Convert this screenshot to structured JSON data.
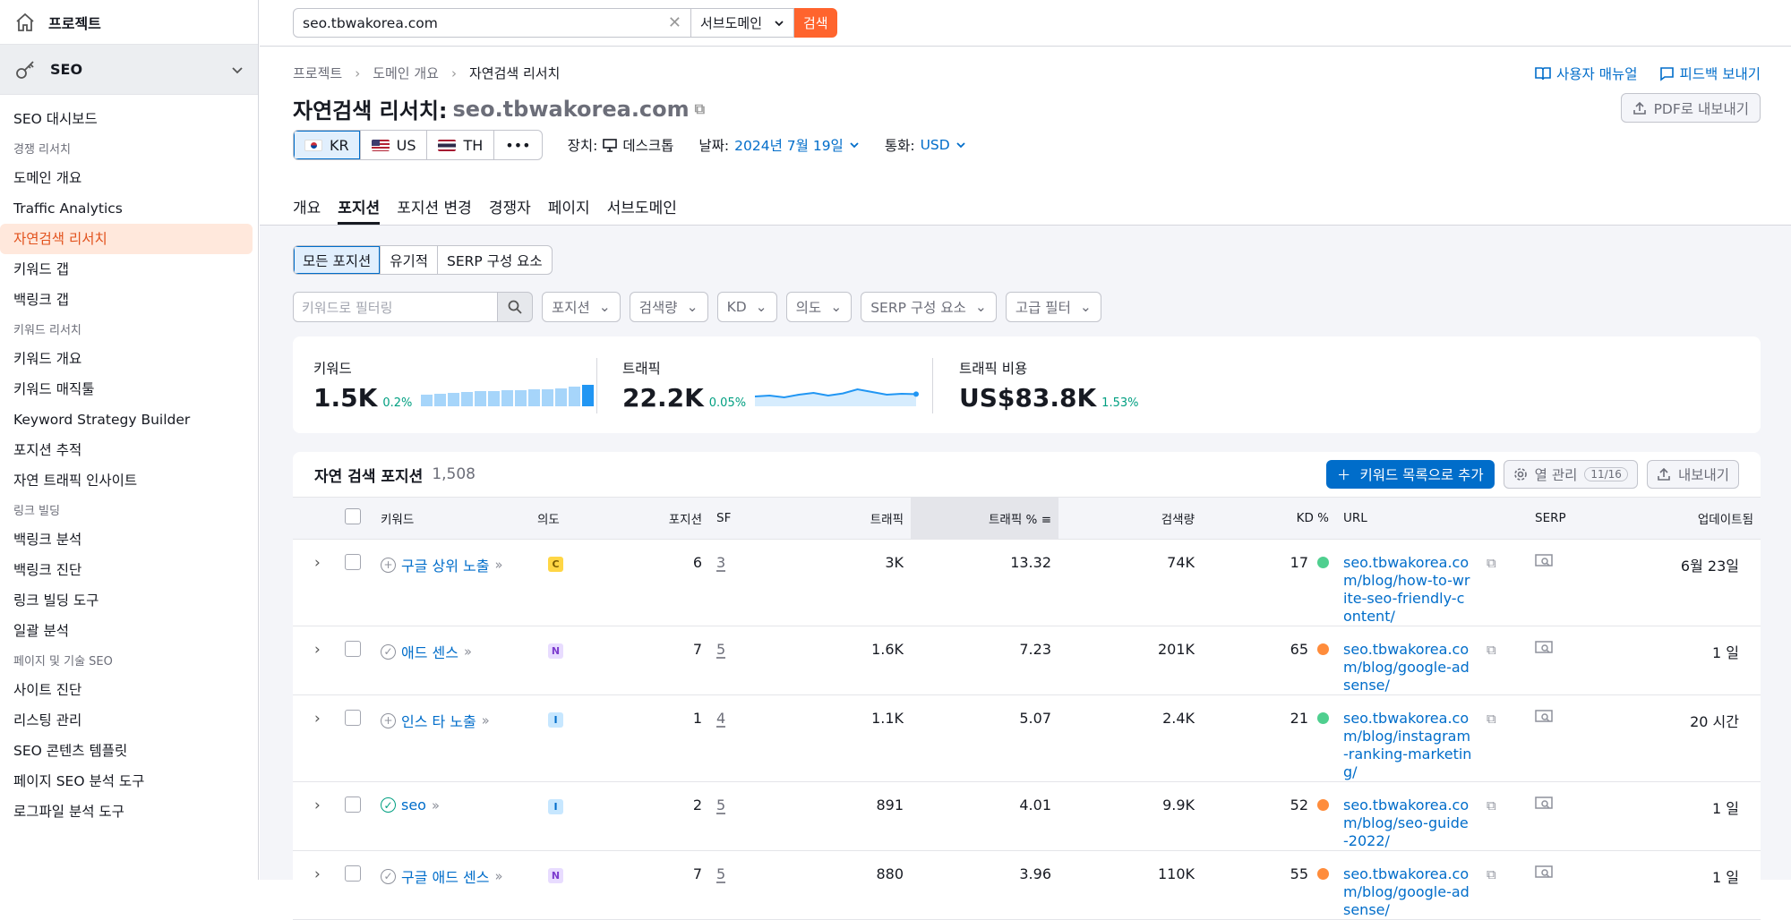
{
  "sidebar": {
    "projects": "프로젝트",
    "seo": "SEO",
    "items": [
      {
        "type": "item",
        "label": "SEO 대시보드"
      },
      {
        "type": "head",
        "label": "경쟁 리서치"
      },
      {
        "type": "item",
        "label": "도메인 개요"
      },
      {
        "type": "item",
        "label": "Traffic Analytics"
      },
      {
        "type": "item",
        "label": "자연검색 리서치",
        "active": true
      },
      {
        "type": "item",
        "label": "키워드 갭"
      },
      {
        "type": "item",
        "label": "백링크 갭"
      },
      {
        "type": "head",
        "label": "키워드 리서치"
      },
      {
        "type": "item",
        "label": "키워드 개요"
      },
      {
        "type": "item",
        "label": "키워드 매직툴"
      },
      {
        "type": "item",
        "label": "Keyword Strategy Builder"
      },
      {
        "type": "item",
        "label": "포지션 추적"
      },
      {
        "type": "item",
        "label": "자연 트래픽 인사이트"
      },
      {
        "type": "head",
        "label": "링크 빌딩"
      },
      {
        "type": "item",
        "label": "백링크 분석"
      },
      {
        "type": "item",
        "label": "백링크 진단"
      },
      {
        "type": "item",
        "label": "링크 빌딩 도구"
      },
      {
        "type": "item",
        "label": "일괄 분석"
      },
      {
        "type": "head",
        "label": "페이지 및 기술 SEO"
      },
      {
        "type": "item",
        "label": "사이트 진단"
      },
      {
        "type": "item",
        "label": "리스팅 관리"
      },
      {
        "type": "item",
        "label": "SEO 콘텐츠 템플릿"
      },
      {
        "type": "item",
        "label": "페이지 SEO 분석 도구"
      },
      {
        "type": "item",
        "label": "로그파일 분석 도구"
      }
    ]
  },
  "search": {
    "domain": "seo.tbwakorea.com",
    "scope": "서브도메인",
    "button": "검색"
  },
  "breadcrumb": {
    "a": "프로젝트",
    "b": "도메인 개요",
    "c": "자연검색 리서치"
  },
  "links": {
    "manual": "사용자 매뉴얼",
    "feedback": "피드백 보내기",
    "pdf": "PDF로 내보내기"
  },
  "title": {
    "label": "자연검색 리서치:",
    "domain": "seo.tbwakorea.com"
  },
  "db": {
    "kr": "KR",
    "us": "US",
    "th": "TH",
    "more": "•••"
  },
  "meta": {
    "device_label": "장치:",
    "device": "데스크톱",
    "date_label": "날짜:",
    "date": "2024년 7월 19일",
    "cur_label": "통화:",
    "currency": "USD"
  },
  "tabs": [
    "개요",
    "포지션",
    "포지션 변경",
    "경쟁자",
    "페이지",
    "서브도메인"
  ],
  "segments": [
    "모든 포지션",
    "유기적",
    "SERP 구성 요소"
  ],
  "filters": {
    "placeholder": "키워드로 필터링",
    "dd": [
      "포지션",
      "검색량",
      "KD",
      "의도",
      "SERP 구성 요소",
      "고급 필터"
    ]
  },
  "kpis": {
    "kw_label": "키워드",
    "kw_value": "1.5K",
    "kw_change": "0.2%",
    "tr_label": "트래픽",
    "tr_value": "22.2K",
    "tr_change": "0.05%",
    "cost_label": "트래픽 비용",
    "cost_value": "US$83.8K",
    "cost_change": "1.53%",
    "kw_bars": [
      0.55,
      0.6,
      0.62,
      0.68,
      0.72,
      0.7,
      0.74,
      0.76,
      0.78,
      0.8,
      0.82,
      0.92,
      1.0
    ],
    "tr_line": [
      0.45,
      0.5,
      0.4,
      0.55,
      0.65,
      0.5,
      0.62,
      0.85,
      0.7,
      0.55,
      0.6,
      0.58
    ]
  },
  "table": {
    "title": "자연 검색 포지션",
    "count": "1,508",
    "add": "키워드 목록으로 추가",
    "cols_label": "열 관리",
    "cols_count": "11/16",
    "export": "내보내기",
    "headers": {
      "kw": "키워드",
      "intent": "의도",
      "pos": "포지션",
      "sf": "SF",
      "traffic": "트래픽",
      "tpct": "트래픽 %",
      "vol": "검색량",
      "kd": "KD %",
      "url": "URL",
      "serp": "SERP",
      "upd": "업데이트됨"
    },
    "rows": [
      {
        "kw": "구글 상위 노출",
        "icon": "plus",
        "intent": "C",
        "pos": "6",
        "sf": "3",
        "traffic": "3K",
        "tpct": "13.32",
        "vol": "74K",
        "kd": "17",
        "kdc": "#4fcf8f",
        "url": "seo.tbwakorea.com/blog/how-to-write-seo-friendly-content/",
        "upd": "6월 23일"
      },
      {
        "kw": "애드 센스",
        "icon": "check",
        "intent": "N",
        "pos": "7",
        "sf": "5",
        "traffic": "1.6K",
        "tpct": "7.23",
        "vol": "201K",
        "kd": "65",
        "kdc": "#ff8c3b",
        "url": "seo.tbwakorea.com/blog/google-adsense/",
        "upd": "1 일"
      },
      {
        "kw": "인스 타 노출",
        "icon": "plus",
        "intent": "I",
        "pos": "1",
        "sf": "4",
        "traffic": "1.1K",
        "tpct": "5.07",
        "vol": "2.4K",
        "kd": "21",
        "kdc": "#4fcf8f",
        "url": "seo.tbwakorea.com/blog/instagram-ranking-marketing/",
        "upd": "20 시간"
      },
      {
        "kw": "seo",
        "icon": "checkg",
        "intent": "I",
        "pos": "2",
        "sf": "5",
        "traffic": "891",
        "tpct": "4.01",
        "vol": "9.9K",
        "kd": "52",
        "kdc": "#ff8c3b",
        "url": "seo.tbwakorea.com/blog/seo-guide-2022/",
        "upd": "1 일"
      },
      {
        "kw": "구글 애드 센스",
        "icon": "check",
        "intent": "N",
        "pos": "7",
        "sf": "5",
        "traffic": "880",
        "tpct": "3.96",
        "vol": "110K",
        "kd": "55",
        "kdc": "#ff8c3b",
        "url": "seo.tbwakorea.com/blog/google-adsense/",
        "upd": "1 일"
      }
    ]
  }
}
